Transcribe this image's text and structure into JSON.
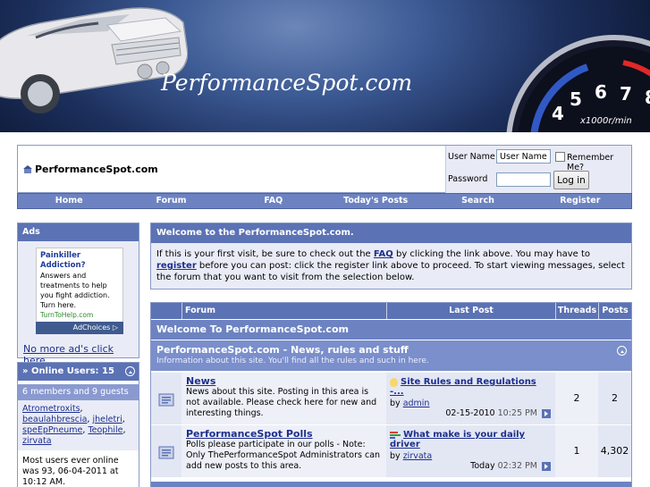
{
  "banner": {
    "logo_text": "PerformanceSpot.com",
    "gauge_numbers": [
      "4",
      "5",
      "6",
      "7",
      "8"
    ],
    "gauge_unit": "x1000r/min"
  },
  "header": {
    "site_name": "PerformanceSpot.com"
  },
  "login": {
    "username_label": "User Name",
    "username_value": "User Name",
    "remember_label": "Remember Me?",
    "password_label": "Password",
    "password_value": "",
    "login_button": "Log in"
  },
  "navbar": {
    "items": [
      "Home",
      "Forum",
      "FAQ",
      "Today's Posts",
      "Search",
      "Register"
    ]
  },
  "ads": {
    "heading": "Ads",
    "ad_title": "Painkiller Addiction?",
    "ad_text": "Answers and treatments to help you fight addiction. Turn here.",
    "ad_url": "TurnToHelp.com",
    "ad_choices": "AdChoices",
    "no_ads_link": "No more ad's click here"
  },
  "online": {
    "heading": "» Online Users: 15",
    "subheading": "6 members and 9 guests",
    "members": [
      "Atrometroxits",
      "beaulahbrescia",
      "jheletri",
      "speEpPneume",
      "Teophile",
      "zirvata"
    ],
    "most_online": "Most users ever online was 93, 06-04-2011 at 10:12 AM."
  },
  "welcome": {
    "heading": "Welcome to the PerformanceSpot.com.",
    "text_1": "If this is your first visit, be sure to check out the ",
    "faq_link": "FAQ",
    "text_2": " by clicking the link above. You may have to ",
    "register_link": "register",
    "text_3": " before you can post: click the register link above to proceed. To start viewing messages, select the forum that you want to visit from the selection below."
  },
  "forum_table": {
    "columns": [
      "Forum",
      "Last Post",
      "Threads",
      "Posts"
    ],
    "category": "Welcome To PerformanceSpot.com",
    "subcategory_title": "PerformanceSpot.com - News, rules and stuff",
    "subcategory_desc": "Information about this site. You'll find all the rules and such in here.",
    "rows": [
      {
        "title": "News",
        "desc": "News about this site. Posting in this area is not available. Please check here for new and interesting things.",
        "last_title": "Site Rules and Regulations -...",
        "by_label": "by",
        "last_by": "admin",
        "last_date": "02-15-2010",
        "last_time": "10:25 PM",
        "threads": "2",
        "posts": "2"
      },
      {
        "title": "PerformanceSpot Polls",
        "desc": "Polls please participate in our polls - Note: Only ThePerformanceSpot Administrators can add new posts to this area.",
        "last_title": "What make is your daily driver",
        "by_label": "by",
        "last_by": "zirvata",
        "last_date": "Today",
        "last_time": "02:32 PM",
        "threads": "1",
        "posts": "4,302"
      }
    ]
  },
  "colors": {
    "header_blue": "#5b72b4",
    "nav_blue": "#6d83c1",
    "link_blue": "#1d2f8c",
    "panel_bg": "#e9ecf6"
  }
}
